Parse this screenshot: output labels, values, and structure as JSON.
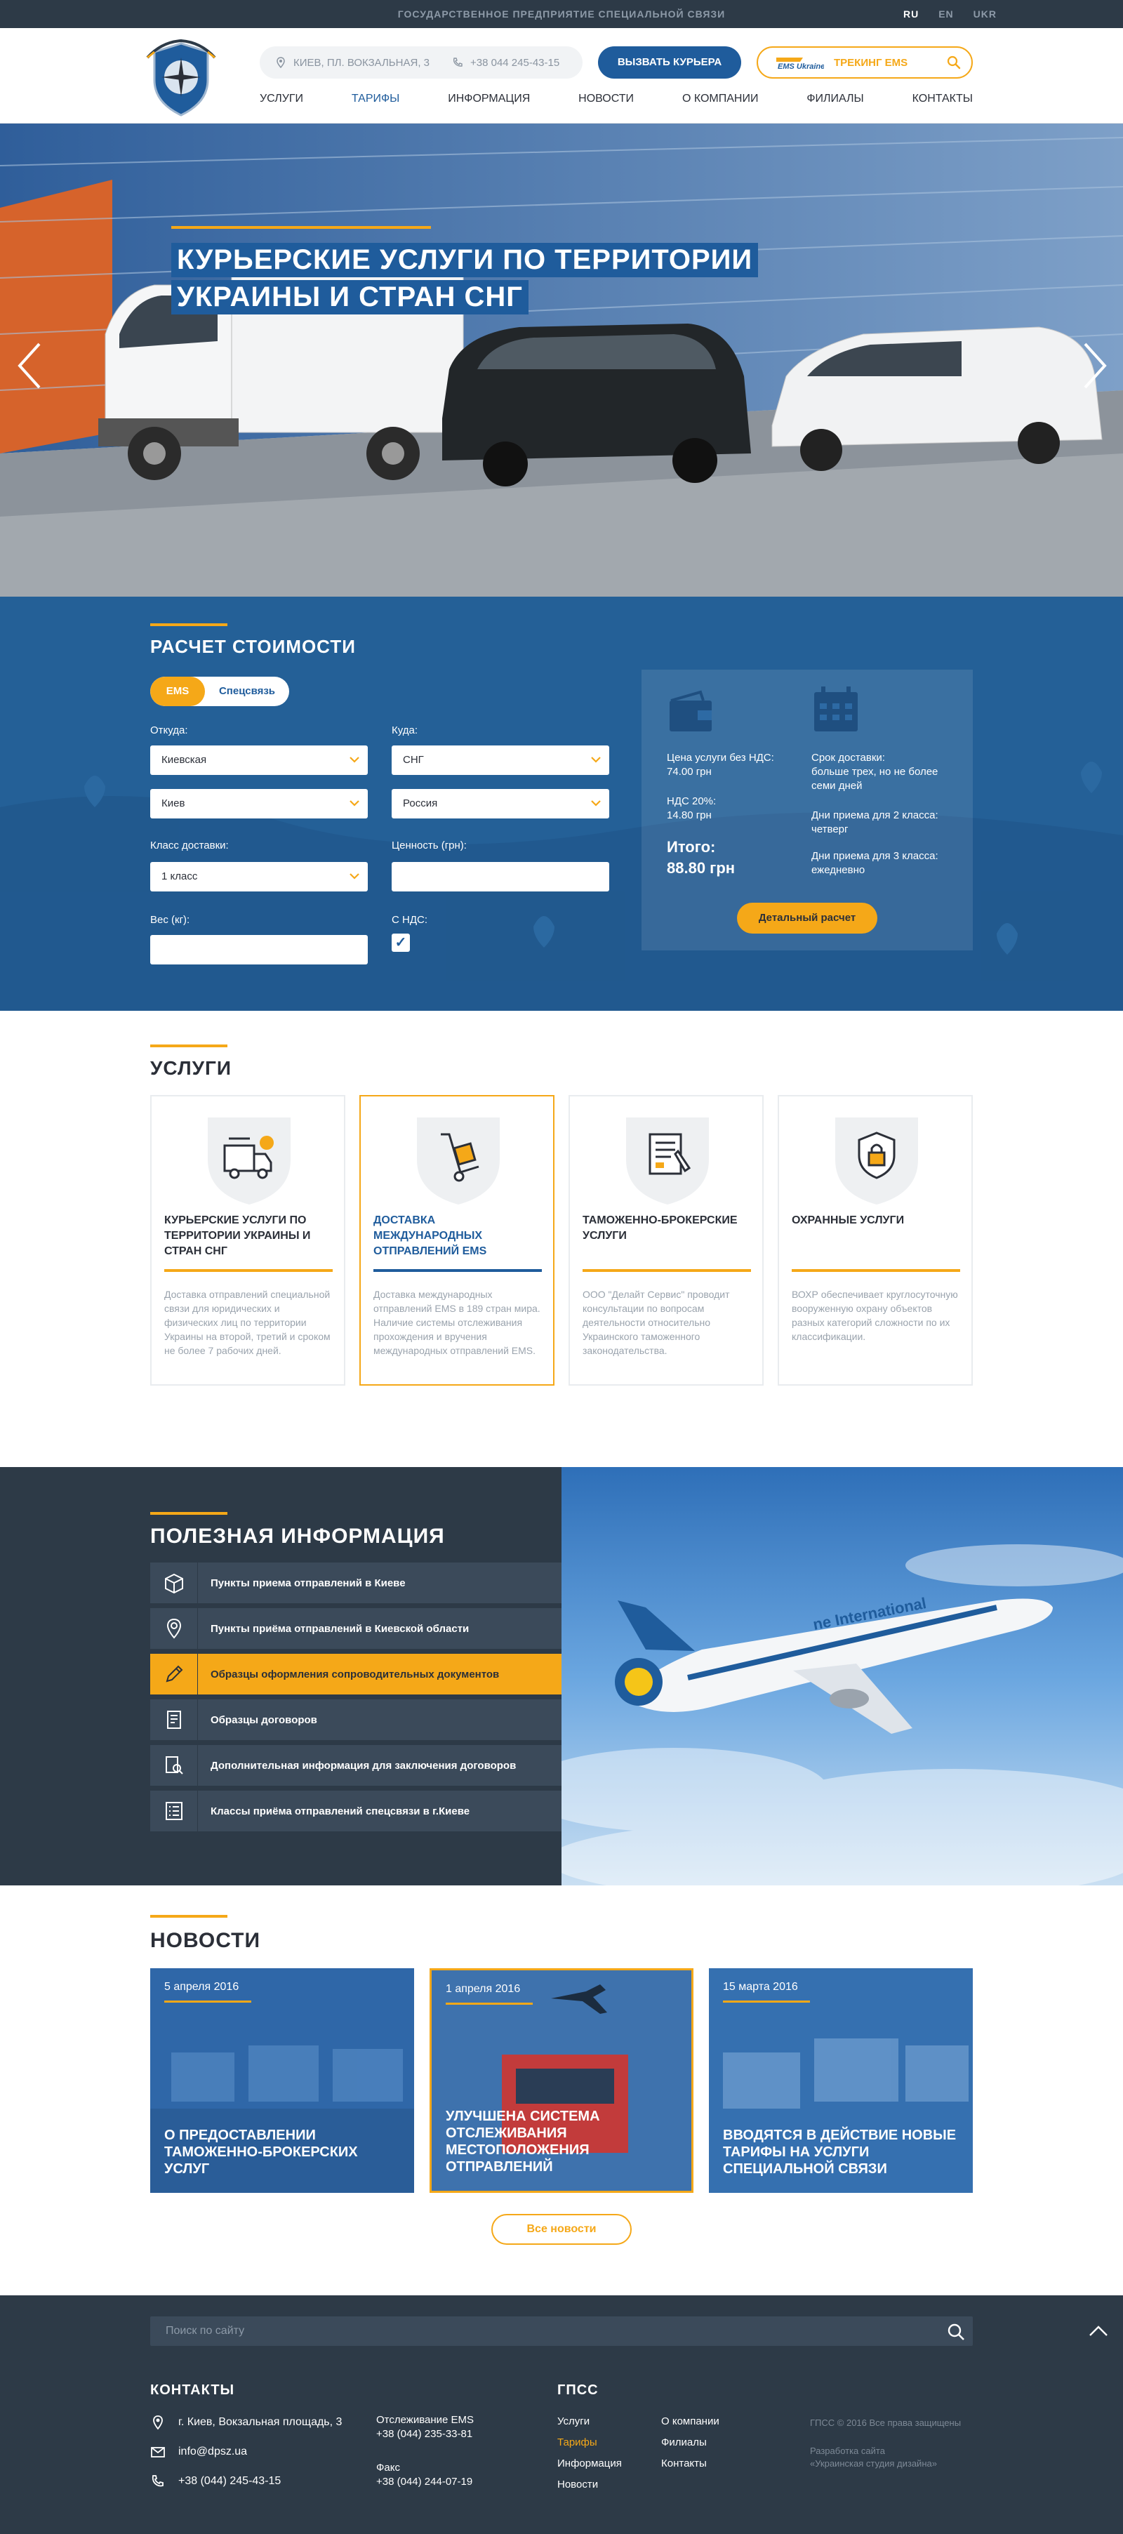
{
  "topbar": {
    "org": "ГОСУДАРСТВЕННОЕ ПРЕДПРИЯТИЕ СПЕЦИАЛЬНОЙ СВЯЗИ",
    "langs": [
      "RU",
      "EN",
      "UKR"
    ],
    "active_lang": "RU"
  },
  "header": {
    "address": "КИЕВ, ПЛ. ВОКЗАЛЬНАЯ, 3",
    "phone": "+38 044 245-43-15",
    "courier_button": "ВЫЗВАТЬ КУРЬЕРА",
    "tracking_label": "ТРЕКИНГ EMS",
    "ems_logo_text": "EMS Ukraine"
  },
  "nav": {
    "items": [
      "УСЛУГИ",
      "ТАРИФЫ",
      "ИНФОРМАЦИЯ",
      "НОВОСТИ",
      "О КОМПАНИИ",
      "ФИЛИАЛЫ",
      "КОНТАКТЫ"
    ],
    "active": "ТАРИФЫ"
  },
  "hero": {
    "title_line1": "КУРЬЕРСКИЕ УСЛУГИ ПО ТЕРРИТОРИИ",
    "title_line2": "УКРАИНЫ И СТРАН СНГ"
  },
  "calc": {
    "title": "РАСЧЕТ СТОИМОСТИ",
    "tabs": [
      "EMS",
      "Спецсвязь"
    ],
    "from_label": "Откуда:",
    "to_label": "Куда:",
    "from_region": "Киевская",
    "from_city": "Киев",
    "to_region": "СНГ",
    "to_country": "Россия",
    "class_label": "Класс доставки:",
    "class_value": "1 класс",
    "value_label": "Ценность (грн):",
    "weight_label": "Вес (кг):",
    "vat_label": "С НДС:",
    "vat_checked": "✓",
    "result": {
      "price_label": "Цена услуги без НДС:",
      "price_value": "74.00 грн",
      "vat_label": "НДС 20%:",
      "vat_value": "14.80 грн",
      "total_label": "Итого:",
      "total_value": "88.80 грн",
      "term_label": "Срок доставки:",
      "term_value": "больше трех, но не более семи дней",
      "days2_label": "Дни приема для 2 класса:",
      "days2_value": "четверг",
      "days3_label": "Дни приема для 3 класса:",
      "days3_value": "ежедневно",
      "detail_button": "Детальный расчет"
    }
  },
  "services": {
    "title": "УСЛУГИ",
    "cards": [
      {
        "title": "КУРЬЕРСКИЕ УСЛУГИ ПО ТЕРРИТОРИИ УКРАИНЫ И СТРАН СНГ",
        "desc": "Доставка отправлений специальной связи для юридических и физических лиц по территории Украины на второй, третий и сроком не более 7 рабочих дней.",
        "icon": "truck-icon"
      },
      {
        "title": "ДОСТАВКА МЕЖДУНАРОДНЫХ ОТПРАВЛЕНИЙ EMS",
        "desc": "Доставка международных отправлений EMS в 189 стран мира. Наличие системы отслеживания прохождения и вручения международных отправлений EMS.",
        "icon": "hand-truck-icon"
      },
      {
        "title": "ТАМОЖЕННО-БРОКЕРСКИЕ УСЛУГИ",
        "desc": "ООО \"Делайт Сервис\" проводит консультации по вопросам деятельности относительно Украинского таможенного законодательства.",
        "icon": "document-icon"
      },
      {
        "title": "ОХРАННЫЕ УСЛУГИ",
        "desc": "ВОХР обеспечивает круглосуточную вооруженную охрану объектов разных категорий сложности по их классификации.",
        "icon": "lock-shield-icon"
      }
    ]
  },
  "info": {
    "title": "ПОЛЕЗНАЯ ИНФОРМАЦИЯ",
    "items": [
      {
        "label": "Пункты приема отправлений в Киеве",
        "icon": "box-icon"
      },
      {
        "label": "Пункты приёма отправлений в Киевской области",
        "icon": "map-pin-icon"
      },
      {
        "label": "Образцы оформления сопроводительных документов",
        "icon": "pencil-icon"
      },
      {
        "label": "Образцы договоров",
        "icon": "contract-icon"
      },
      {
        "label": "Дополнительная информация для заключения договоров",
        "icon": "search-document-icon"
      },
      {
        "label": "Классы приёма отправлений спецсвязи в г.Киеве",
        "icon": "list-icon"
      }
    ],
    "active_index": 2,
    "plane_text": "ne International"
  },
  "news": {
    "title": "НОВОСТИ",
    "items": [
      {
        "date": "5 апреля 2016",
        "title": "О ПРЕДОСТАВЛЕНИИ ТАМОЖЕННО-БРОКЕРСКИХ УСЛУГ"
      },
      {
        "date": "1 апреля 2016",
        "title": "УЛУЧШЕНА СИСТЕМА ОТСЛЕЖИВАНИЯ МЕСТОПОЛОЖЕНИЯ ОТПРАВЛЕНИЙ"
      },
      {
        "date": "15 марта 2016",
        "title": "ВВОДЯТСЯ В ДЕЙСТВИЕ НОВЫЕ ТАРИФЫ НА УСЛУГИ СПЕЦИАЛЬНОЙ СВЯЗИ"
      }
    ],
    "all_button": "Все новости"
  },
  "footer": {
    "search_placeholder": "Поиск по сайту",
    "contacts_title": "КОНТАКТЫ",
    "address": "г. Киев, Вокзальная площадь, 3",
    "email": "info@dpsz.ua",
    "phone": "+38 (044) 245-43-15",
    "ems_label": "Отслеживание EMS",
    "ems_phone": "+38 (044) 235-33-81",
    "fax_label": "Факс",
    "fax_phone": "+38 (044) 244-07-19",
    "gpss_title": "ГПСС",
    "links_col1": [
      "Услуги",
      "Тарифы",
      "Информация",
      "Новости"
    ],
    "links_col2": [
      "О компании",
      "Филиалы",
      "Контакты"
    ],
    "copyright": "ГПСС © 2016 Все права защищены",
    "dev_line1": "Разработка сайта",
    "dev_line2": "«Украинская студия дизайна»"
  },
  "colors": {
    "brand_blue": "#1f5c9c",
    "accent_orange": "#f5a818",
    "dark": "#2d3a47"
  }
}
